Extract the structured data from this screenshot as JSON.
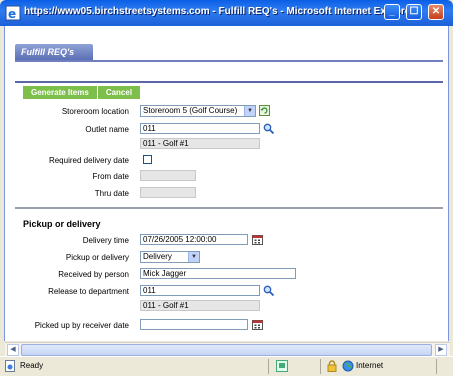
{
  "window": {
    "title": "https://www05.birchstreetsystems.com - Fulfill REQ's - Microsoft Internet Explorer",
    "min_glyph": "_",
    "max_glyph": "☐",
    "close_glyph": "✕"
  },
  "page": {
    "tab_title": "Fulfill REQ's",
    "actions": {
      "generate_label": "Generate Items",
      "cancel_label": "Cancel"
    }
  },
  "form": {
    "storeroom_label": "Storeroom location",
    "storeroom_value": "Storeroom 5 (Golf Course)",
    "outlet_label": "Outlet name",
    "outlet_value": "011",
    "outlet_desc": "011 - Golf #1",
    "required_date_label": "Required delivery date",
    "from_date_label": "From date",
    "from_date_value": "",
    "thru_date_label": "Thru date",
    "thru_date_value": ""
  },
  "pickup": {
    "section_title": "Pickup or delivery",
    "delivery_time_label": "Delivery time",
    "delivery_time_value": "07/26/2005 12:00:00",
    "pickup_or_delivery_label": "Pickup or delivery",
    "pickup_or_delivery_value": "Delivery",
    "received_by_label": "Received by person",
    "received_by_value": "Mick Jagger",
    "release_dept_label": "Release to department",
    "release_dept_value": "011",
    "release_dept_desc": "011 - Golf #1",
    "picked_up_label": "Picked up by receiver date",
    "picked_up_value": ""
  },
  "statusbar": {
    "status": "Ready",
    "zone": "Internet"
  },
  "colors": {
    "title_blue": "#0a5fe6",
    "tab_purple": "#6f7fbf",
    "action_green": "#7dbf4a"
  },
  "icons": [
    "ie-logo-icon",
    "refresh-icon",
    "search-icon",
    "calendar-icon",
    "lock-icon",
    "globe-icon",
    "page-icon"
  ]
}
